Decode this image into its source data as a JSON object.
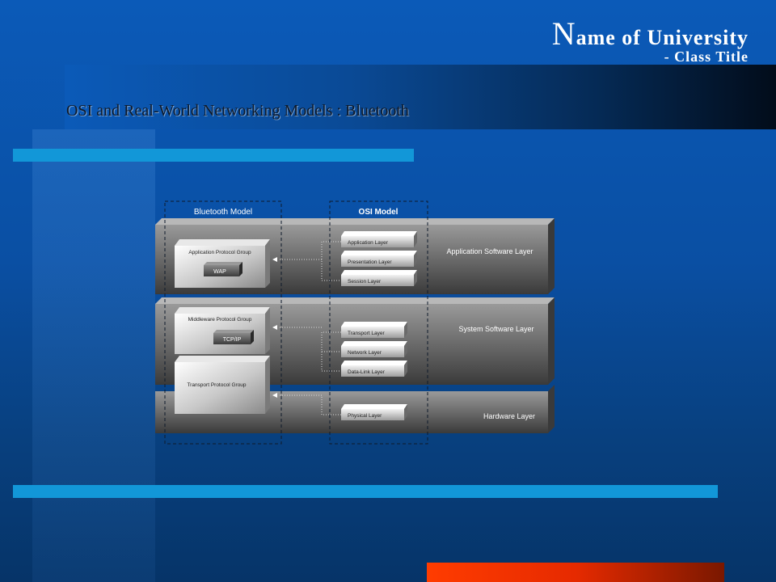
{
  "header": {
    "uni_initial": "N",
    "uni_rest": "ame of University",
    "class_title": "- Class Title"
  },
  "slide": {
    "title": "OSI and Real-World Networking Models : Bluetooth"
  },
  "diagram": {
    "bluetooth_heading": "Bluetooth Model",
    "osi_heading": "OSI Model",
    "rows": {
      "application": "Application Software Layer",
      "system": "System Software Layer",
      "hardware": "Hardware Layer"
    },
    "bluetooth_groups": {
      "application": "Application Protocol Group",
      "wap": "WAP",
      "middleware": "Middleware Protocol Group",
      "tcpip": "TCP/IP",
      "transport": "Transport Protocol Group"
    },
    "osi_layers": [
      "Application Layer",
      "Presentation Layer",
      "Session Layer",
      "Transport Layer",
      "Network Layer",
      "Data-Link Layer",
      "Physical Layer"
    ]
  }
}
